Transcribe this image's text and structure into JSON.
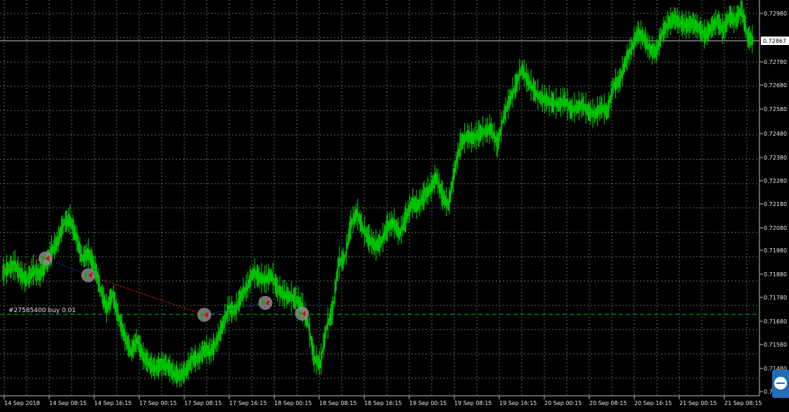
{
  "chart_data": {
    "type": "line",
    "symbol_note": "",
    "y_ticks": [
      "0.72980",
      "0.72780",
      "0.72680",
      "0.72580",
      "0.72480",
      "0.72380",
      "0.72280",
      "0.72180",
      "0.72080",
      "0.71980",
      "0.71880",
      "0.71780",
      "0.71680",
      "0.71580",
      "0.71480",
      "0.7"
    ],
    "current_price": "0.72867",
    "x_ticks": [
      "14 Sep 2018",
      "14 Sep 08:15",
      "14 Sep 16:15",
      "17 Sep 00:15",
      "17 Sep 08:15",
      "17 Sep 16:15",
      "18 Sep 00:15",
      "18 Sep 08:15",
      "18 Sep 16:15",
      "19 Sep 00:15",
      "19 Sep 08:15",
      "19 Sep 16:15",
      "20 Sep 00:15",
      "20 Sep 08:15",
      "20 Sep 16:15",
      "21 Sep 00:15",
      "21 Sep 08:15"
    ],
    "order_label": "#27585400 buy 0.01",
    "order_level": 0.71727,
    "ylim": [
      0.7139,
      0.7305
    ],
    "grid": true,
    "series": [
      {
        "values": [
          0.719,
          0.7192,
          0.7193,
          0.7189,
          0.7187,
          0.7191,
          0.7189,
          0.7193,
          0.7199,
          0.7203,
          0.7211,
          0.7212,
          0.7205,
          0.7196,
          0.7198,
          0.7193,
          0.7183,
          0.7175,
          0.7181,
          0.7171,
          0.7163,
          0.7157,
          0.7162,
          0.7155,
          0.7152,
          0.715,
          0.7152,
          0.7151,
          0.7148,
          0.7147,
          0.7149,
          0.7154,
          0.7154,
          0.7158,
          0.7157,
          0.7161,
          0.7168,
          0.7175,
          0.7174,
          0.718,
          0.7184,
          0.719,
          0.7188,
          0.7187,
          0.7189,
          0.7183,
          0.7181,
          0.718,
          0.7179,
          0.7176,
          0.7169,
          0.7154,
          0.7152,
          0.7167,
          0.7174,
          0.7194,
          0.7196,
          0.721,
          0.7215,
          0.7208,
          0.7204,
          0.7201,
          0.7203,
          0.7209,
          0.7211,
          0.7206,
          0.7213,
          0.7219,
          0.7218,
          0.7222,
          0.7225,
          0.723,
          0.7222,
          0.7218,
          0.7233,
          0.7244,
          0.7247,
          0.7246,
          0.7248,
          0.7249,
          0.725,
          0.7243,
          0.7255,
          0.7262,
          0.7268,
          0.7275,
          0.727,
          0.7266,
          0.7263,
          0.7262,
          0.7261,
          0.726,
          0.7262,
          0.7258,
          0.7259,
          0.726,
          0.7257,
          0.7256,
          0.7259,
          0.7257,
          0.7268,
          0.727,
          0.7278,
          0.7284,
          0.729,
          0.7288,
          0.7283,
          0.7282,
          0.729,
          0.7294,
          0.7296,
          0.7294,
          0.7293,
          0.7294,
          0.7292,
          0.7289,
          0.7292,
          0.7295,
          0.7291,
          0.7297,
          0.7295,
          0.73,
          0.7288,
          0.7287
        ],
        "color": "#00c800"
      }
    ],
    "trades": [
      {
        "from": {
          "i": 7,
          "p": 0.7196
        },
        "to": {
          "i": 14,
          "p": 0.7189
        },
        "color": "#1f3fff"
      },
      {
        "from": {
          "i": 14,
          "p": 0.7189
        },
        "to": {
          "i": 33,
          "p": 0.71725
        },
        "color": "#ff2020"
      },
      {
        "from": {
          "i": 33,
          "p": 0.71725
        },
        "to": {
          "i": 43,
          "p": 0.71775
        },
        "color": "#1f3fff"
      },
      {
        "from": {
          "i": 0,
          "p": 0.71915
        },
        "to": {
          "i": 7,
          "p": 0.7196
        },
        "color": "#ff2020"
      }
    ],
    "trade_markers": [
      {
        "i": 7,
        "p": 0.7196
      },
      {
        "i": 14,
        "p": 0.7189
      },
      {
        "i": 33,
        "p": 0.71725
      },
      {
        "i": 43,
        "p": 0.71775
      },
      {
        "i": 49,
        "p": 0.7173
      }
    ],
    "colors": {
      "background": "#000000",
      "grid": "#5a6f5a",
      "axis": "#c0c0c0",
      "order_line": "#00c000",
      "marker_fill": "#8a8a8a"
    }
  }
}
